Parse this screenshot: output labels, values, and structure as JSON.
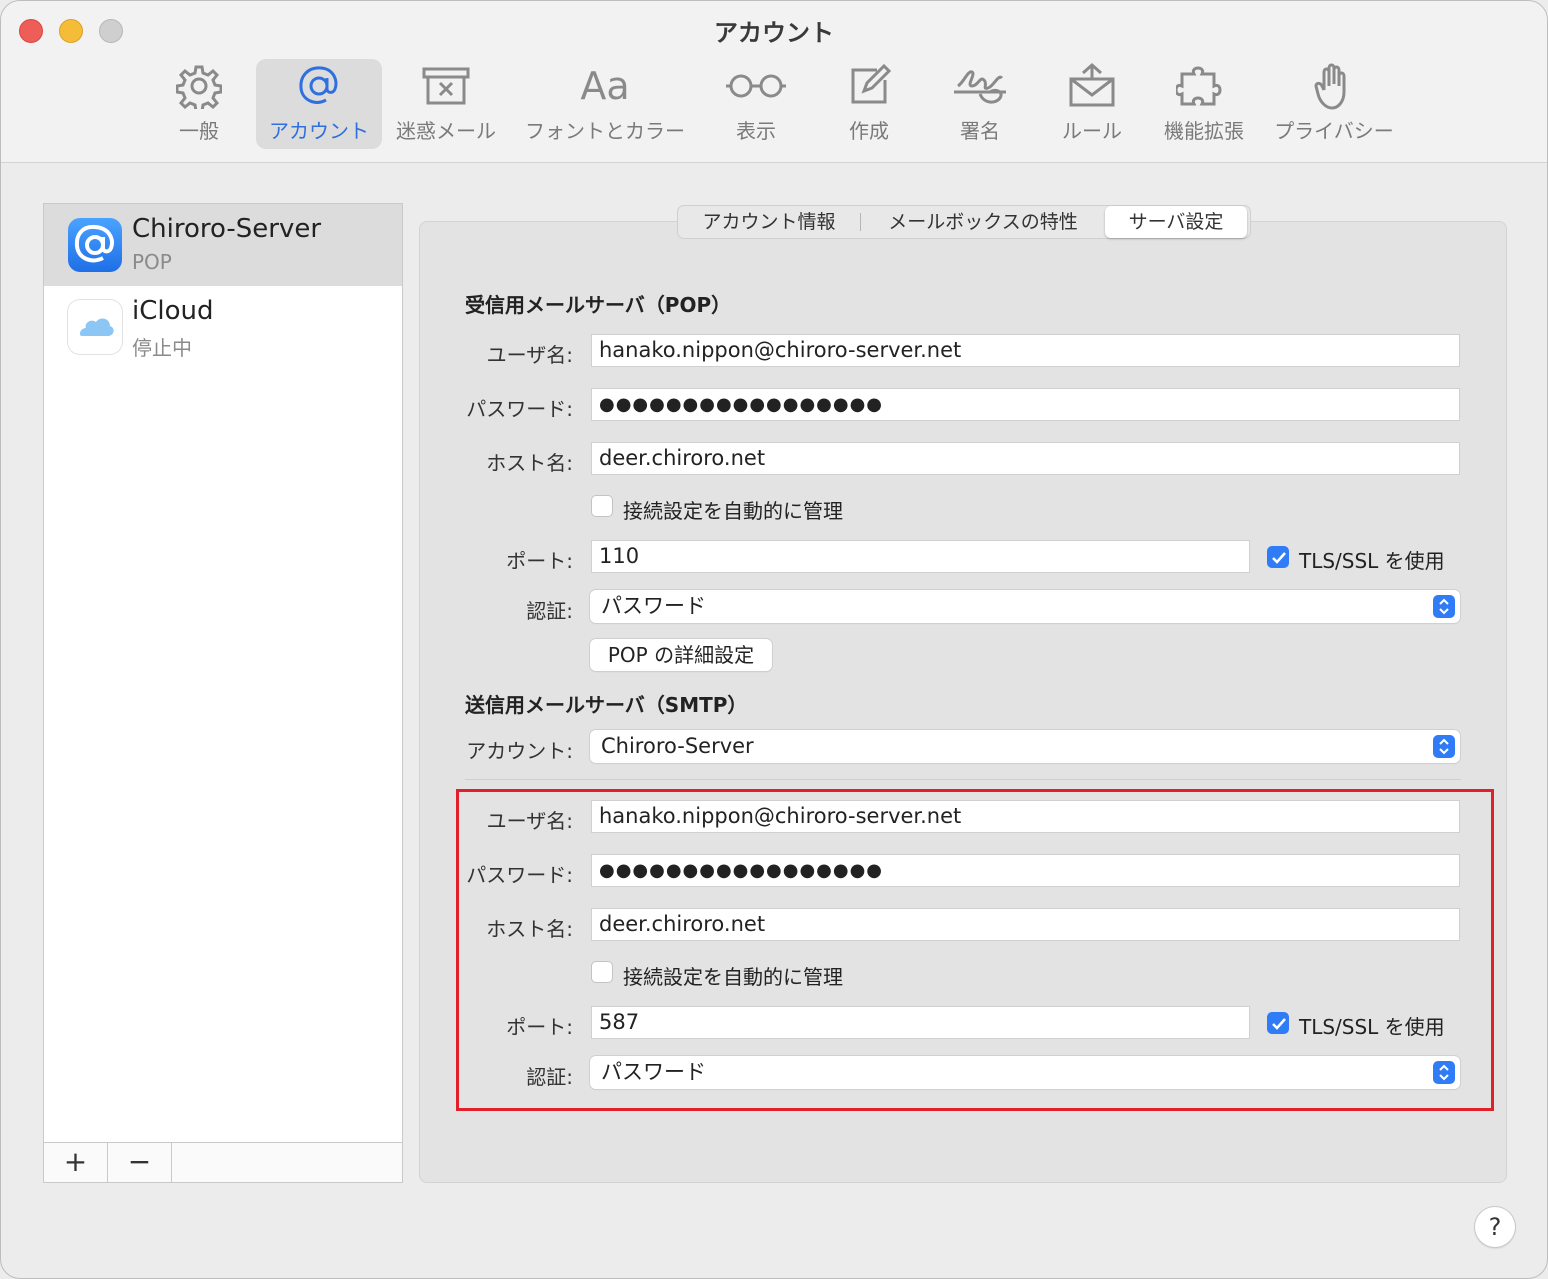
{
  "window": {
    "title": "アカウント"
  },
  "toolbar": {
    "items": [
      {
        "label": "一般",
        "icon": "gear-icon"
      },
      {
        "label": "アカウント",
        "icon": "at-sign-icon",
        "active": true
      },
      {
        "label": "迷惑メール",
        "icon": "junk-tray-icon"
      },
      {
        "label": "フォントとカラー",
        "icon": "font-aa-icon",
        "glyph": "Aa"
      },
      {
        "label": "表示",
        "icon": "glasses-icon"
      },
      {
        "label": "作成",
        "icon": "compose-icon"
      },
      {
        "label": "署名",
        "icon": "signature-icon"
      },
      {
        "label": "ルール",
        "icon": "rules-envelope-icon"
      },
      {
        "label": "機能拡張",
        "icon": "puzzle-icon"
      },
      {
        "label": "プライバシー",
        "icon": "hand-icon"
      }
    ]
  },
  "sidebar": {
    "accounts": [
      {
        "name": "Chiroro-Server",
        "subtitle": "POP",
        "icon": "at-sign-mail-icon",
        "selected": true
      },
      {
        "name": "iCloud",
        "subtitle": "停止中",
        "icon": "icloud-icon"
      }
    ],
    "add_label": "+",
    "remove_label": "−"
  },
  "tabs": {
    "items": [
      "アカウント情報",
      "メールボックスの特性",
      "サーバ設定"
    ],
    "active": "サーバ設定"
  },
  "incoming": {
    "title": "受信用メールサーバ（POP）",
    "username_label": "ユーザ名:",
    "username": "hanako.nippon@chiroro-server.net",
    "password_label": "パスワード:",
    "password": "●●●●●●●●●●●●●●●●●",
    "host_label": "ホスト名:",
    "host": "deer.chiroro.net",
    "auto_manage_label": "接続設定を自動的に管理",
    "auto_manage": false,
    "port_label": "ポート:",
    "port": "110",
    "tls_label": "TLS/SSL を使用",
    "tls": true,
    "auth_label": "認証:",
    "auth": "パスワード",
    "advanced_button": "POP の詳細設定"
  },
  "outgoing": {
    "title": "送信用メールサーバ（SMTP）",
    "account_label": "アカウント:",
    "account": "Chiroro-Server",
    "username_label": "ユーザ名:",
    "username": "hanako.nippon@chiroro-server.net",
    "password_label": "パスワード:",
    "password": "●●●●●●●●●●●●●●●●●",
    "host_label": "ホスト名:",
    "host": "deer.chiroro.net",
    "auto_manage_label": "接続設定を自動的に管理",
    "auto_manage": false,
    "port_label": "ポート:",
    "port": "587",
    "tls_label": "TLS/SSL を使用",
    "tls": true,
    "auth_label": "認証:",
    "auth": "パスワード"
  },
  "help": {
    "label": "?"
  },
  "colors": {
    "accent": "#2f7cf6",
    "highlight_border": "#e0202a",
    "active_tab_text": "#2f6fe0"
  }
}
